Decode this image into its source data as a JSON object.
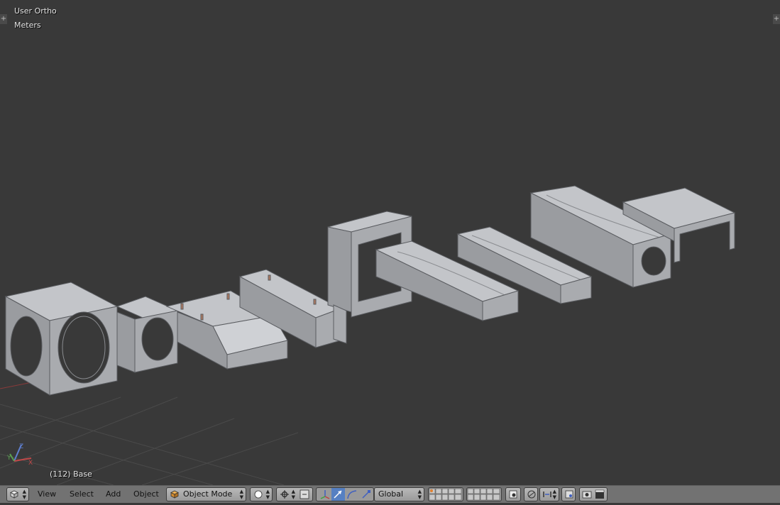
{
  "viewport": {
    "view_name": "User Ortho",
    "units": "Meters",
    "object_info": "(112) Base"
  },
  "header": {
    "menus": [
      "View",
      "Select",
      "Add",
      "Object"
    ],
    "mode": "Object Mode",
    "transform_orientation": "Global"
  },
  "icons": {
    "editor_type": "cube-icon",
    "viewport_shading": "solid-sphere-icon",
    "pivot": "pivot-point-icon",
    "manipulator": "manipulator-icon"
  },
  "colors": {
    "background": "#393939",
    "header": "#727272",
    "mesh": "#a5a7ab"
  }
}
